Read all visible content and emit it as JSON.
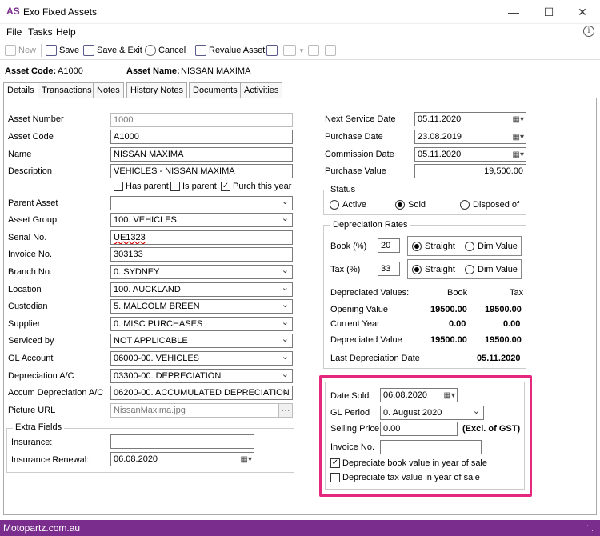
{
  "app": {
    "logo": "AS",
    "title": "Exo Fixed Assets"
  },
  "window_controls": {
    "minimize": "—",
    "maximize": "☐",
    "close": "✕"
  },
  "menu": [
    "File",
    "Tasks",
    "Help"
  ],
  "toolbar": {
    "new": "New",
    "save": "Save",
    "save_exit": "Save & Exit",
    "cancel": "Cancel",
    "revalue": "Revalue Asset"
  },
  "header": {
    "asset_code_label": "Asset Code:",
    "asset_code": "A1000",
    "asset_name_label": "Asset Name:",
    "asset_name": "NISSAN MAXIMA"
  },
  "tabs": [
    "Details",
    "Transactions",
    "Notes",
    "History Notes",
    "Documents",
    "Activities"
  ],
  "left": {
    "asset_number": {
      "label": "Asset Number",
      "value": "1000"
    },
    "asset_code": {
      "label": "Asset Code",
      "value": "A1000"
    },
    "name": {
      "label": "Name",
      "value": "NISSAN MAXIMA"
    },
    "description": {
      "label": "Description",
      "value": "VEHICLES - NISSAN MAXIMA"
    },
    "checks": {
      "has_parent": "Has parent",
      "is_parent": "Is parent",
      "purch_this_year": "Purch this year",
      "purch_checked": "✓"
    },
    "parent_asset": {
      "label": "Parent Asset",
      "value": ""
    },
    "asset_group": {
      "label": "Asset Group",
      "value": "100. VEHICLES"
    },
    "serial_no": {
      "label": "Serial No.",
      "value": "UE1323"
    },
    "invoice_no": {
      "label": "Invoice No.",
      "value": "303133"
    },
    "branch_no": {
      "label": "Branch No.",
      "value": "0. SYDNEY"
    },
    "location": {
      "label": "Location",
      "value": "100. AUCKLAND"
    },
    "custodian": {
      "label": "Custodian",
      "value": "5. MALCOLM BREEN"
    },
    "supplier": {
      "label": "Supplier",
      "value": "0. MISC PURCHASES"
    },
    "serviced_by": {
      "label": "Serviced by",
      "value": "NOT APPLICABLE"
    },
    "gl_account": {
      "label": "GL Account",
      "value": "06000-00. VEHICLES"
    },
    "depreciation_ac": {
      "label": "Depreciation A/C",
      "value": "03300-00. DEPRECIATION"
    },
    "accum_dep": {
      "label": "Accum Depreciation A/C",
      "value": "06200-00. ACCUMULATED DEPRECIATION"
    },
    "picture_url": {
      "label": "Picture URL",
      "value": "NissanMaxima.jpg",
      "button": "···"
    }
  },
  "extra_fields": {
    "title": "Extra Fields",
    "insurance": {
      "label": "Insurance:",
      "value": ""
    },
    "insurance_renewal": {
      "label": "Insurance Renewal:",
      "value": "06.08.2020"
    }
  },
  "right": {
    "next_service_date": {
      "label": "Next Service Date",
      "value": "05.11.2020"
    },
    "purchase_date": {
      "label": "Purchase Date",
      "value": "23.08.2019"
    },
    "commission_date": {
      "label": "Commission Date",
      "value": "05.11.2020"
    },
    "purchase_value": {
      "label": "Purchase Value",
      "value": "19,500.00"
    }
  },
  "status": {
    "title": "Status",
    "active": "Active",
    "sold": "Sold",
    "disposed": "Disposed of"
  },
  "dep_rates": {
    "title": "Depreciation Rates",
    "book_label": "Book (%)",
    "book_value": "20",
    "tax_label": "Tax (%)",
    "tax_value": "33",
    "straight": "Straight",
    "dim_value": "Dim Value",
    "values_title": "Depreciated Values:",
    "col_book": "Book",
    "col_tax": "Tax",
    "rows": [
      {
        "label": "Opening Value",
        "book": "19500.00",
        "tax": "19500.00"
      },
      {
        "label": "Current Year",
        "book": "0.00",
        "tax": "0.00"
      },
      {
        "label": "Depreciated Value",
        "book": "19500.00",
        "tax": "19500.00"
      }
    ],
    "last_dep_label": "Last Depreciation Date",
    "last_dep_value": "05.11.2020"
  },
  "sale": {
    "date_sold": {
      "label": "Date Sold",
      "value": "06.08.2020"
    },
    "gl_period": {
      "label": "GL Period",
      "value": "0. August 2020"
    },
    "selling_price": {
      "label": "Selling Price",
      "value": "0.00",
      "note": "(Excl. of GST)"
    },
    "invoice_no": {
      "label": "Invoice No.",
      "value": ""
    },
    "dep_book": {
      "label": "Depreciate book value in year of sale",
      "mark": "✓"
    },
    "dep_tax": {
      "label": "Depreciate tax value in year of sale"
    }
  },
  "footer": "Motopartz.com.au",
  "colors": {
    "brand": "#7b2d8e",
    "highlight": "#e6277e"
  }
}
